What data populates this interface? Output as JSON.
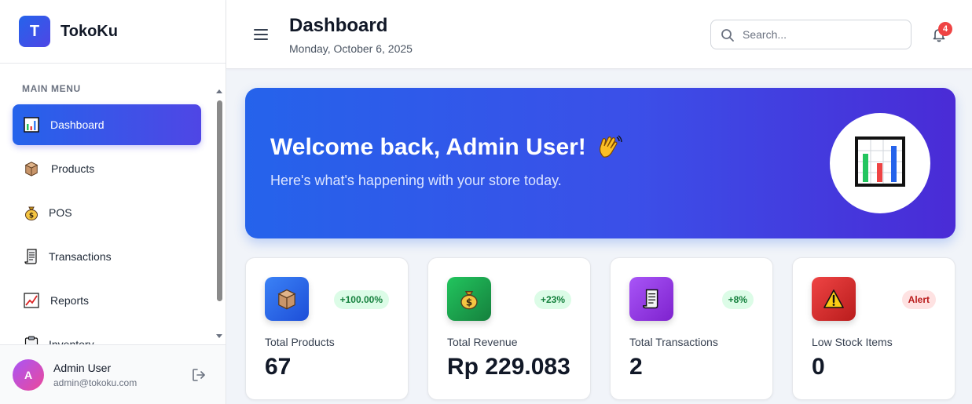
{
  "brand": {
    "logo_letter": "T",
    "name": "TokoKu"
  },
  "sidebar": {
    "section_title": "MAIN MENU",
    "items": [
      {
        "label": "Dashboard"
      },
      {
        "label": "Products"
      },
      {
        "label": "POS"
      },
      {
        "label": "Transactions"
      },
      {
        "label": "Reports"
      },
      {
        "label": "Inventory"
      }
    ]
  },
  "user": {
    "initial": "A",
    "name": "Admin User",
    "email": "admin@tokoku.com"
  },
  "header": {
    "title": "Dashboard",
    "date": "Monday, October 6, 2025",
    "search_placeholder": "Search...",
    "notification_count": "4"
  },
  "banner": {
    "title": "Welcome back, Admin User!",
    "subtitle": "Here's what's happening with your store today."
  },
  "stats": [
    {
      "label": "Total Products",
      "value": "67",
      "badge": "+100.00%"
    },
    {
      "label": "Total Revenue",
      "value": "Rp 229.083",
      "badge": "+23%"
    },
    {
      "label": "Total Transactions",
      "value": "2",
      "badge": "+8%"
    },
    {
      "label": "Low Stock Items",
      "value": "0",
      "badge": "Alert"
    }
  ],
  "colors": {
    "primary": "#2563eb",
    "accent": "#4f46e5",
    "success_bg": "#dcfce7",
    "success_text": "#15803d",
    "alert_bg": "#fee2e2",
    "alert_text": "#b91c1c"
  },
  "icons": {
    "dashboard": "bar-chart-icon",
    "products": "package-icon",
    "pos": "money-bag-icon",
    "transactions": "receipt-icon",
    "reports": "trend-chart-icon",
    "inventory": "clipboard-icon"
  }
}
